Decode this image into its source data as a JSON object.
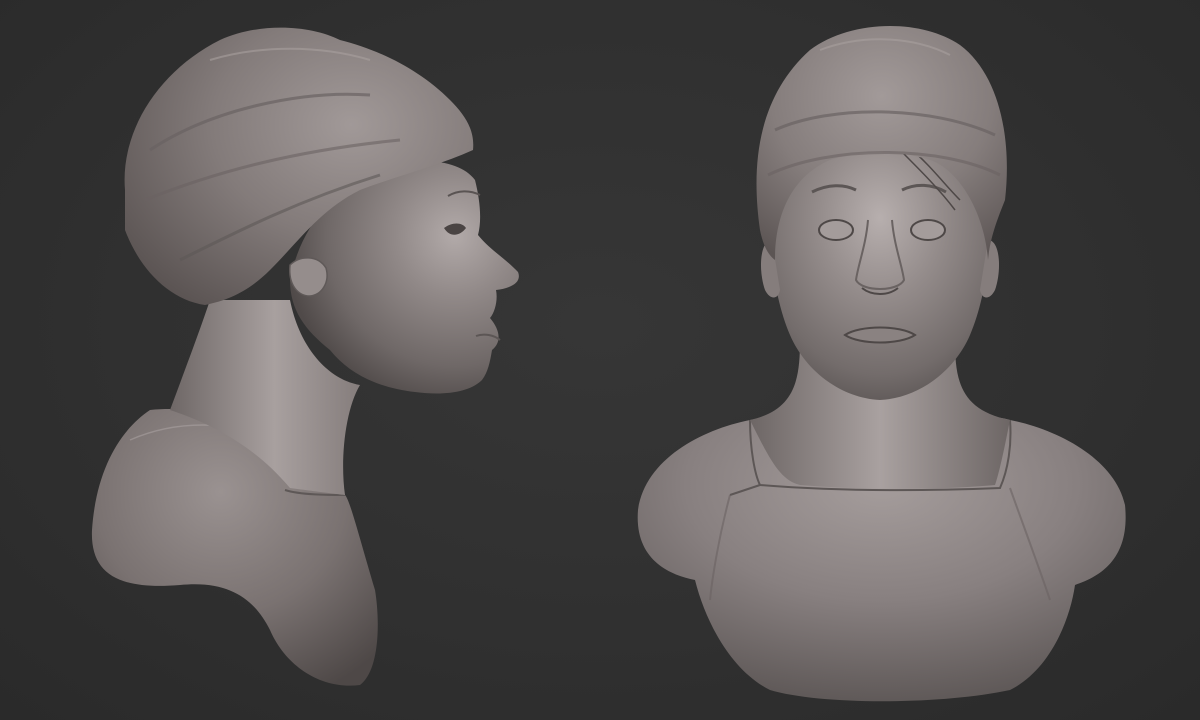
{
  "scene": {
    "background_color": "#2f2f2f",
    "material_color": "#8c8483",
    "views": [
      {
        "name": "side-view",
        "subject": "sculpted-bust-profile"
      },
      {
        "name": "front-view",
        "subject": "sculpted-bust-front"
      }
    ]
  }
}
